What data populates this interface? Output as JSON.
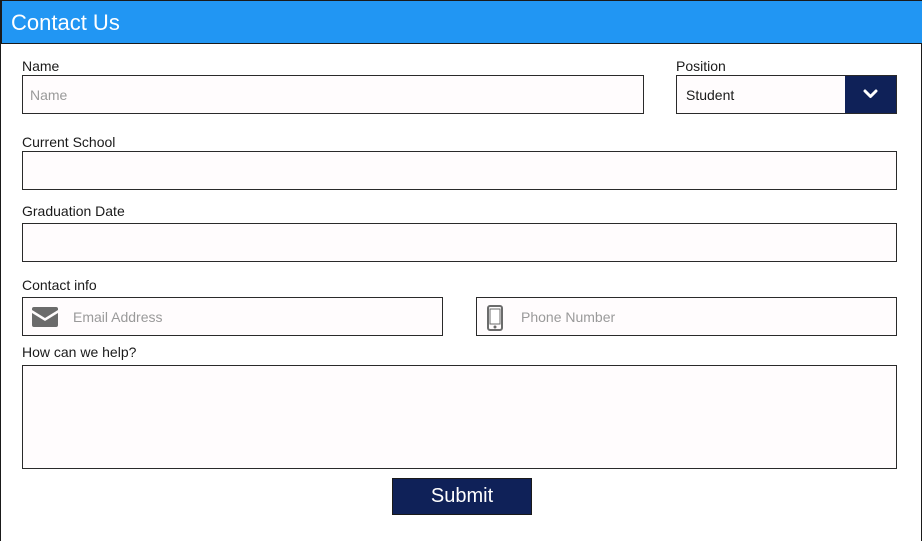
{
  "header": {
    "title": "Contact Us",
    "color": "#2196f3"
  },
  "form": {
    "name": {
      "label": "Name",
      "placeholder": "Name",
      "value": ""
    },
    "position": {
      "label": "Position",
      "selected": "Student",
      "dropdown_icon": "chevron-down-icon"
    },
    "current_school": {
      "label": "Current School",
      "value": ""
    },
    "graduation_date": {
      "label": "Graduation Date",
      "value": ""
    },
    "contact_info": {
      "label": "Contact info",
      "email": {
        "placeholder": "Email Address",
        "icon": "envelope-icon"
      },
      "phone": {
        "placeholder": "Phone Number",
        "icon": "mobile-phone-icon"
      }
    },
    "help": {
      "label": "How can we help?",
      "value": ""
    },
    "submit_label": "Submit"
  },
  "colors": {
    "accent": "#0f2158",
    "field_bg": "#fffcfd"
  }
}
